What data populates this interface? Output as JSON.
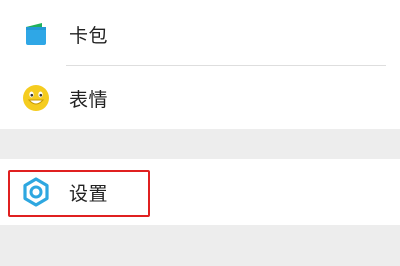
{
  "menu": {
    "items": [
      {
        "label": "卡包",
        "icon": "wallet-icon"
      },
      {
        "label": "表情",
        "icon": "smiley-icon"
      },
      {
        "label": "设置",
        "icon": "gear-icon"
      }
    ]
  },
  "colors": {
    "wallet_green": "#20b05c",
    "wallet_blue": "#2fa7e6",
    "smiley_yellow": "#f5cc1f",
    "gear_blue": "#2ea7e0",
    "highlight_red": "#e02020",
    "background_gray": "#ededed"
  }
}
